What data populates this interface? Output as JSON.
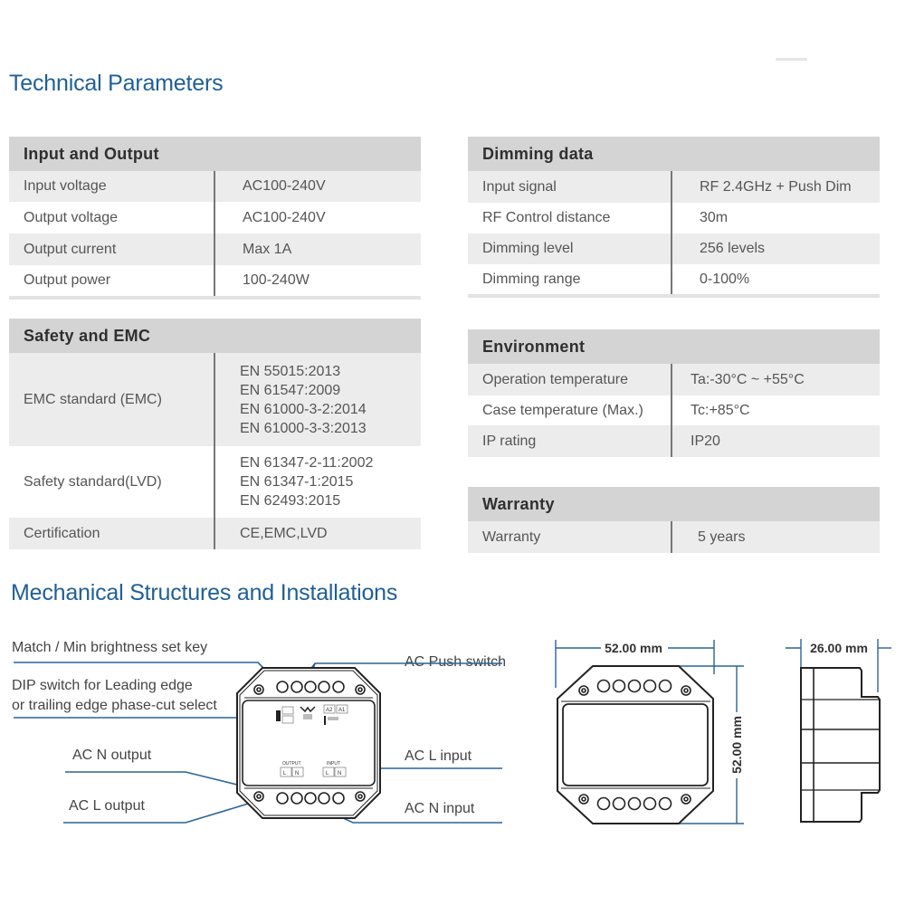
{
  "titles": {
    "technical": "Technical Parameters",
    "mechanical": "Mechanical Structures and Installations"
  },
  "tables": {
    "input_output": {
      "header": "Input and Output",
      "rows": [
        {
          "label": "Input voltage",
          "value": "AC100-240V"
        },
        {
          "label": "Output voltage",
          "value": "AC100-240V"
        },
        {
          "label": "Output current",
          "value": "Max 1A"
        },
        {
          "label": "Output power",
          "value": "100-240W"
        }
      ]
    },
    "dimming": {
      "header": "Dimming data",
      "rows": [
        {
          "label": "Input signal",
          "value": "RF 2.4GHz + Push Dim"
        },
        {
          "label": "RF Control distance",
          "value": "30m"
        },
        {
          "label": "Dimming level",
          "value": "256 levels"
        },
        {
          "label": "Dimming range",
          "value": "0-100%"
        }
      ]
    },
    "safety": {
      "header": "Safety and EMC",
      "rows": [
        {
          "label": "EMC standard (EMC)",
          "values": [
            "EN 55015:2013",
            "EN 61547:2009",
            "EN 61000-3-2:2014",
            "EN 61000-3-3:2013"
          ]
        },
        {
          "label": "Safety standard(LVD)",
          "values": [
            "EN 61347-2-11:2002",
            "EN 61347-1:2015",
            "EN 62493:2015"
          ]
        },
        {
          "label": "Certification",
          "values": [
            "CE,EMC,LVD"
          ]
        }
      ]
    },
    "environment": {
      "header": "Environment",
      "rows": [
        {
          "label": "Operation temperature",
          "value": "Ta:-30°C ~ +55°C"
        },
        {
          "label": "Case temperature (Max.)",
          "value": "Tc:+85°C"
        },
        {
          "label": "IP rating",
          "value": "IP20"
        }
      ]
    },
    "warranty": {
      "header": "Warranty",
      "rows": [
        {
          "label": "Warranty",
          "value": "5 years"
        }
      ]
    }
  },
  "diagram": {
    "callouts": {
      "match_key": "Match / Min brightness set key",
      "dip_line1": "DIP switch for Leading edge",
      "dip_line2": "or trailing edge phase-cut select",
      "push_switch": "AC Push switch",
      "n_output": "AC N output",
      "l_output": "AC L output",
      "l_input": "AC L input",
      "n_input": "AC N input"
    },
    "device_labels": {
      "output": "OUTPUT",
      "input": "INPUT",
      "l": "L",
      "n": "N",
      "a2": "A2",
      "a1": "A1"
    },
    "dimensions": {
      "width": "52.00 mm",
      "height": "52.00 mm",
      "depth": "26.00 mm"
    }
  },
  "colors": {
    "title_blue": "#1f5f97",
    "leader_blue": "#2a6496",
    "header_gray": "#d4d4d4",
    "row_gray": "#ececec"
  }
}
